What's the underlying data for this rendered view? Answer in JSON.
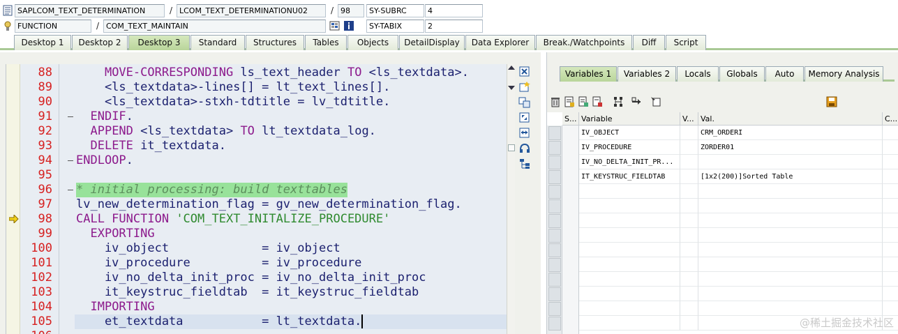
{
  "header": {
    "row1": {
      "program": "SAPLCOM_TEXT_DETERMINATION",
      "include": "LCOM_TEXT_DETERMINATIONU02",
      "line": "98",
      "sysvar_name": "SY-SUBRC",
      "sysvar_value": "4"
    },
    "row2": {
      "event_type": "FUNCTION",
      "event_name": "COM_TEXT_MAINTAIN",
      "sysvar_name": "SY-TABIX",
      "sysvar_value": "2"
    },
    "separator": "/"
  },
  "tabs": [
    {
      "label": "Desktop 1",
      "active": false
    },
    {
      "label": "Desktop 2",
      "active": false
    },
    {
      "label": "Desktop 3",
      "active": true
    },
    {
      "label": "Standard",
      "active": false
    },
    {
      "label": "Structures",
      "active": false
    },
    {
      "label": "Tables",
      "active": false
    },
    {
      "label": "Objects",
      "active": false
    },
    {
      "label": "DetailDisplay",
      "active": false
    },
    {
      "label": "Data Explorer",
      "active": false
    },
    {
      "label": "Break./Watchpoints",
      "active": false
    },
    {
      "label": "Diff",
      "active": false
    },
    {
      "label": "Script",
      "active": false
    }
  ],
  "editor": {
    "current_line": "105",
    "execution_line": "98",
    "lines": [
      {
        "no": "88",
        "text": "    MOVE-CORRESPONDING ls_text_header TO <ls_textdata>."
      },
      {
        "no": "89",
        "text": "    <ls_textdata>-lines[] = lt_text_lines[]."
      },
      {
        "no": "90",
        "text": "    <ls_textdata>-stxh-tdtitle = lv_tdtitle."
      },
      {
        "no": "91",
        "text": "  ENDIF."
      },
      {
        "no": "92",
        "text": "  APPEND <ls_textdata> TO lt_textdata_log."
      },
      {
        "no": "93",
        "text": "  DELETE it_textdata."
      },
      {
        "no": "94",
        "text": "ENDLOOP."
      },
      {
        "no": "95",
        "text": ""
      },
      {
        "no": "96",
        "text": "* initial processing: build texttables"
      },
      {
        "no": "97",
        "text": "lv_new_determination_flag = gv_new_determination_flag."
      },
      {
        "no": "98",
        "text": "CALL FUNCTION 'COM_TEXT_INITALIZE_PROCEDURE'"
      },
      {
        "no": "99",
        "text": "  EXPORTING"
      },
      {
        "no": "100",
        "text": "    iv_object             = iv_object"
      },
      {
        "no": "101",
        "text": "    iv_procedure          = iv_procedure"
      },
      {
        "no": "102",
        "text": "    iv_no_delta_init_proc = iv_no_delta_init_proc"
      },
      {
        "no": "103",
        "text": "    it_keystruc_fieldtab  = it_keystruc_fieldtab"
      },
      {
        "no": "104",
        "text": "  IMPORTING"
      },
      {
        "no": "105",
        "text": "    et_textdata           = lt_textdata."
      },
      {
        "no": "106",
        "text": ""
      }
    ]
  },
  "right_tabs": [
    {
      "label": "Variables 1",
      "active": true
    },
    {
      "label": "Variables 2",
      "active": false
    },
    {
      "label": "Locals",
      "active": false
    },
    {
      "label": "Globals",
      "active": false
    },
    {
      "label": "Auto",
      "active": false
    },
    {
      "label": "Memory Analysis",
      "active": false
    }
  ],
  "variables_grid": {
    "columns": [
      "S...",
      "Variable",
      "V...",
      "Val.",
      "C..."
    ],
    "rows": [
      {
        "variable": "IV_OBJECT",
        "value": "CRM_ORDERI"
      },
      {
        "variable": "IV_PROCEDURE",
        "value": "ZORDER01"
      },
      {
        "variable": "IV_NO_DELTA_INIT_PR...",
        "value": ""
      },
      {
        "variable": "IT_KEYSTRUC_FIELDTAB",
        "value": "[1x2(200)]Sorted Table"
      },
      {
        "variable": "",
        "value": ""
      },
      {
        "variable": "",
        "value": ""
      },
      {
        "variable": "",
        "value": ""
      },
      {
        "variable": "",
        "value": ""
      },
      {
        "variable": "",
        "value": ""
      },
      {
        "variable": "",
        "value": ""
      },
      {
        "variable": "",
        "value": ""
      },
      {
        "variable": "",
        "value": ""
      },
      {
        "variable": "",
        "value": ""
      },
      {
        "variable": "",
        "value": ""
      }
    ]
  },
  "watermark": "@稀土掘金技术社区",
  "colors": {
    "tab_active": "#b9d59a",
    "line_number": "#d62020",
    "keyword": "#8c1a8c",
    "string": "#2f8a2f",
    "comment_bg": "#98e29a",
    "identifier": "#1a1f6e"
  }
}
